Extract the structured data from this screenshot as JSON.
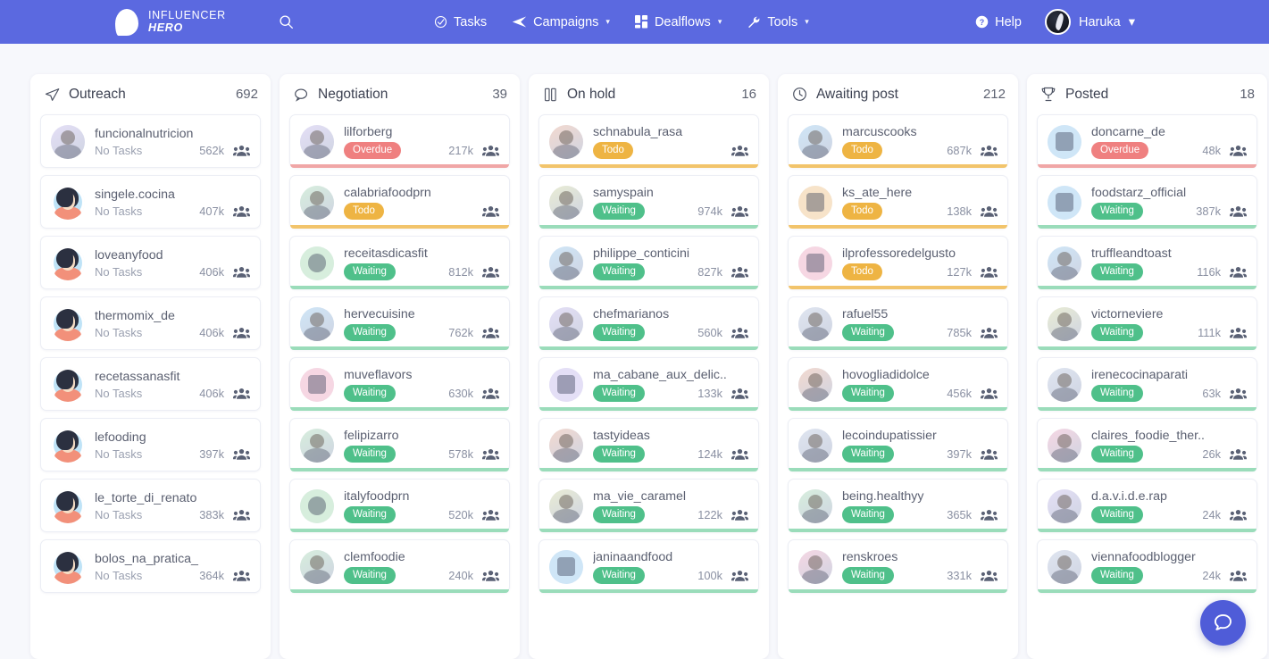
{
  "nav": {
    "brand_line1": "INFLUENCER",
    "brand_line2": "HERO",
    "search_icon": "search-icon",
    "items": [
      {
        "label": "Tasks",
        "icon": "check-circle-icon",
        "has_caret": false
      },
      {
        "label": "Campaigns",
        "icon": "paper-plane-icon",
        "has_caret": true
      },
      {
        "label": "Dealflows",
        "icon": "grid-squares-icon",
        "has_caret": true
      },
      {
        "label": "Tools",
        "icon": "wrench-icon",
        "has_caret": true
      }
    ],
    "help_label": "Help",
    "help_icon": "question-circle-icon",
    "user_label": "Haruka",
    "accent": "#5b69e0"
  },
  "chat": {
    "icon": "chat-bubble-icon",
    "color": "#4f5cd8"
  },
  "status_colors": {
    "overdue": "#ef8080",
    "todo": "#eeb443",
    "waiting": "#4fc08a",
    "none": "#9aa0b0"
  },
  "columns": [
    {
      "title": "Outreach",
      "count": "692",
      "icon": "paper-plane-icon",
      "cards": [
        {
          "username": "funcionalnutricion",
          "status": "none",
          "status_label": "No Tasks",
          "followers": "562k",
          "avatar": "photo"
        },
        {
          "username": "singele.cocina",
          "status": "none",
          "status_label": "No Tasks",
          "followers": "407k",
          "avatar": "face"
        },
        {
          "username": "loveanyfood",
          "status": "none",
          "status_label": "No Tasks",
          "followers": "406k",
          "avatar": "face"
        },
        {
          "username": "thermomix_de",
          "status": "none",
          "status_label": "No Tasks",
          "followers": "406k",
          "avatar": "face"
        },
        {
          "username": "recetassanasfit",
          "status": "none",
          "status_label": "No Tasks",
          "followers": "406k",
          "avatar": "face"
        },
        {
          "username": "lefooding",
          "status": "none",
          "status_label": "No Tasks",
          "followers": "397k",
          "avatar": "face"
        },
        {
          "username": "le_torte_di_renato",
          "status": "none",
          "status_label": "No Tasks",
          "followers": "383k",
          "avatar": "face"
        },
        {
          "username": "bolos_na_pratica_",
          "status": "none",
          "status_label": "No Tasks",
          "followers": "364k",
          "avatar": "face"
        }
      ]
    },
    {
      "title": "Negotiation",
      "count": "39",
      "icon": "speech-bubble-icon",
      "cards": [
        {
          "username": "lilforberg",
          "status": "overdue",
          "status_label": "Overdue",
          "followers": "217k",
          "avatar": "photo"
        },
        {
          "username": "calabriafoodprn",
          "status": "todo",
          "status_label": "Todo",
          "followers": "",
          "avatar": "photo"
        },
        {
          "username": "receitasdicasfit",
          "status": "waiting",
          "status_label": "Waiting",
          "followers": "812k",
          "avatar": "logo"
        },
        {
          "username": "hervecuisine",
          "status": "waiting",
          "status_label": "Waiting",
          "followers": "762k",
          "avatar": "photo"
        },
        {
          "username": "muveflavors",
          "status": "waiting",
          "status_label": "Waiting",
          "followers": "630k",
          "avatar": "logo"
        },
        {
          "username": "felipizarro",
          "status": "waiting",
          "status_label": "Waiting",
          "followers": "578k",
          "avatar": "photo"
        },
        {
          "username": "italyfoodprn",
          "status": "waiting",
          "status_label": "Waiting",
          "followers": "520k",
          "avatar": "logo"
        },
        {
          "username": "clemfoodie",
          "status": "waiting",
          "status_label": "Waiting",
          "followers": "240k",
          "avatar": "photo"
        }
      ]
    },
    {
      "title": "On hold",
      "count": "16",
      "icon": "pause-bars-icon",
      "cards": [
        {
          "username": "schnabula_rasa",
          "status": "todo",
          "status_label": "Todo",
          "followers": "",
          "avatar": "photo"
        },
        {
          "username": "samyspain",
          "status": "waiting",
          "status_label": "Waiting",
          "followers": "974k",
          "avatar": "photo"
        },
        {
          "username": "philippe_conticini",
          "status": "waiting",
          "status_label": "Waiting",
          "followers": "827k",
          "avatar": "photo"
        },
        {
          "username": "chefmarianos",
          "status": "waiting",
          "status_label": "Waiting",
          "followers": "560k",
          "avatar": "photo"
        },
        {
          "username": "ma_cabane_aux_delic..",
          "status": "waiting",
          "status_label": "Waiting",
          "followers": "133k",
          "avatar": "logo"
        },
        {
          "username": "tastyideas",
          "status": "waiting",
          "status_label": "Waiting",
          "followers": "124k",
          "avatar": "photo"
        },
        {
          "username": "ma_vie_caramel",
          "status": "waiting",
          "status_label": "Waiting",
          "followers": "122k",
          "avatar": "photo"
        },
        {
          "username": "janinaandfood",
          "status": "waiting",
          "status_label": "Waiting",
          "followers": "100k",
          "avatar": "logo"
        }
      ]
    },
    {
      "title": "Awaiting post",
      "count": "212",
      "icon": "clock-icon",
      "cards": [
        {
          "username": "marcuscooks",
          "status": "todo",
          "status_label": "Todo",
          "followers": "687k",
          "avatar": "photo"
        },
        {
          "username": "ks_ate_here",
          "status": "todo",
          "status_label": "Todo",
          "followers": "138k",
          "avatar": "logo"
        },
        {
          "username": "ilprofessoredelgusto",
          "status": "todo",
          "status_label": "Todo",
          "followers": "127k",
          "avatar": "logo"
        },
        {
          "username": "rafuel55",
          "status": "waiting",
          "status_label": "Waiting",
          "followers": "785k",
          "avatar": "photo"
        },
        {
          "username": "hovogliadidolce",
          "status": "waiting",
          "status_label": "Waiting",
          "followers": "456k",
          "avatar": "photo"
        },
        {
          "username": "lecoindupatissier",
          "status": "waiting",
          "status_label": "Waiting",
          "followers": "397k",
          "avatar": "photo"
        },
        {
          "username": "being.healthyy",
          "status": "waiting",
          "status_label": "Waiting",
          "followers": "365k",
          "avatar": "photo"
        },
        {
          "username": "renskroes",
          "status": "waiting",
          "status_label": "Waiting",
          "followers": "331k",
          "avatar": "photo"
        }
      ]
    },
    {
      "title": "Posted",
      "count": "18",
      "icon": "trophy-icon",
      "cards": [
        {
          "username": "doncarne_de",
          "status": "overdue",
          "status_label": "Overdue",
          "followers": "48k",
          "avatar": "logo"
        },
        {
          "username": "foodstarz_official",
          "status": "waiting",
          "status_label": "Waiting",
          "followers": "387k",
          "avatar": "logo"
        },
        {
          "username": "truffleandtoast",
          "status": "waiting",
          "status_label": "Waiting",
          "followers": "116k",
          "avatar": "photo"
        },
        {
          "username": "victorneviere",
          "status": "waiting",
          "status_label": "Waiting",
          "followers": "111k",
          "avatar": "photo"
        },
        {
          "username": "irenecocinaparati",
          "status": "waiting",
          "status_label": "Waiting",
          "followers": "63k",
          "avatar": "photo"
        },
        {
          "username": "claires_foodie_ther..",
          "status": "waiting",
          "status_label": "Waiting",
          "followers": "26k",
          "avatar": "photo"
        },
        {
          "username": "d.a.v.i.d.e.rap",
          "status": "waiting",
          "status_label": "Waiting",
          "followers": "24k",
          "avatar": "photo"
        },
        {
          "username": "viennafoodblogger",
          "status": "waiting",
          "status_label": "Waiting",
          "followers": "24k",
          "avatar": "photo"
        }
      ]
    }
  ]
}
